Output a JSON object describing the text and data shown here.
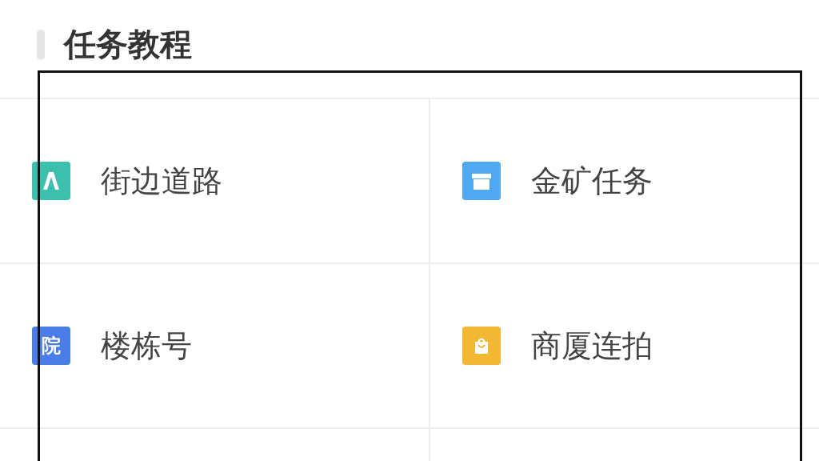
{
  "title": "任务教程",
  "items": [
    {
      "label": "街边道路",
      "kind": "road",
      "color": "#3dbfae"
    },
    {
      "label": "金矿任务",
      "kind": "store",
      "color": "#4fa8f0"
    },
    {
      "label": "楼栋号",
      "kind": "glyph",
      "glyph": "院",
      "color": "#4a7de8"
    },
    {
      "label": "商厦连拍",
      "kind": "bag",
      "color": "#f2b733"
    }
  ]
}
